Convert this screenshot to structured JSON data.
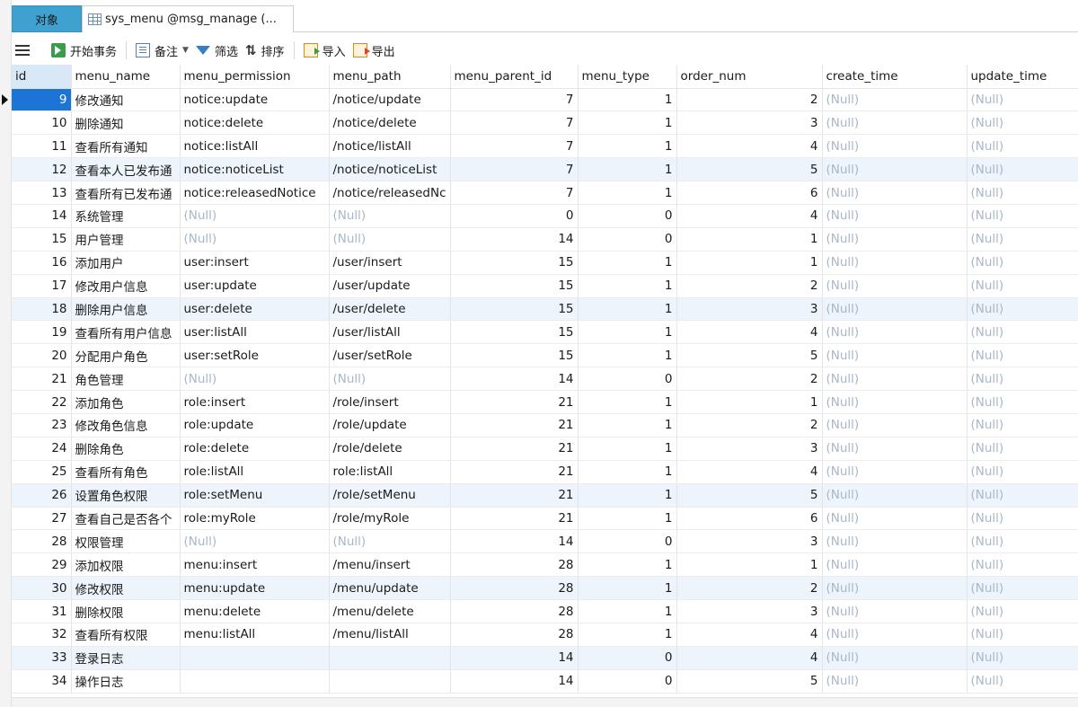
{
  "tabs": {
    "objects": "对象",
    "table": "sys_menu @msg_manage (..."
  },
  "toolbar": {
    "begin_transaction": "开始事务",
    "note": "备注",
    "filter": "筛选",
    "sort": "排序",
    "import": "导入",
    "export": "导出"
  },
  "columns": [
    "id",
    "menu_name",
    "menu_permission",
    "menu_path",
    "menu_parent_id",
    "menu_type",
    "order_num",
    "create_time",
    "update_time"
  ],
  "null_text": "(Null)",
  "rows": [
    {
      "id": "9",
      "menu_name": "修改通知",
      "menu_permission": "notice:update",
      "menu_path": "/notice/update",
      "menu_parent_id": "7",
      "menu_type": "1",
      "order_num": "2",
      "create_time": "(Null)",
      "update_time": "(Null)"
    },
    {
      "id": "10",
      "menu_name": "删除通知",
      "menu_permission": "notice:delete",
      "menu_path": "/notice/delete",
      "menu_parent_id": "7",
      "menu_type": "1",
      "order_num": "3",
      "create_time": "(Null)",
      "update_time": "(Null)"
    },
    {
      "id": "11",
      "menu_name": "查看所有通知",
      "menu_permission": "notice:listAll",
      "menu_path": "/notice/listAll",
      "menu_parent_id": "7",
      "menu_type": "1",
      "order_num": "4",
      "create_time": "(Null)",
      "update_time": "(Null)"
    },
    {
      "id": "12",
      "menu_name": "查看本人已发布通",
      "menu_permission": "notice:noticeList",
      "menu_path": "/notice/noticeList",
      "menu_parent_id": "7",
      "menu_type": "1",
      "order_num": "5",
      "create_time": "(Null)",
      "update_time": "(Null)"
    },
    {
      "id": "13",
      "menu_name": "查看所有已发布通",
      "menu_permission": "notice:releasedNotice",
      "menu_path": "/notice/releasedNc",
      "menu_parent_id": "7",
      "menu_type": "1",
      "order_num": "6",
      "create_time": "(Null)",
      "update_time": "(Null)"
    },
    {
      "id": "14",
      "menu_name": "系统管理",
      "menu_permission": "(Null)",
      "menu_path": "(Null)",
      "menu_parent_id": "0",
      "menu_type": "0",
      "order_num": "4",
      "create_time": "(Null)",
      "update_time": "(Null)"
    },
    {
      "id": "15",
      "menu_name": "用户管理",
      "menu_permission": "(Null)",
      "menu_path": "(Null)",
      "menu_parent_id": "14",
      "menu_type": "0",
      "order_num": "1",
      "create_time": "(Null)",
      "update_time": "(Null)"
    },
    {
      "id": "16",
      "menu_name": "添加用户",
      "menu_permission": "user:insert",
      "menu_path": "/user/insert",
      "menu_parent_id": "15",
      "menu_type": "1",
      "order_num": "1",
      "create_time": "(Null)",
      "update_time": "(Null)"
    },
    {
      "id": "17",
      "menu_name": "修改用户信息",
      "menu_permission": "user:update",
      "menu_path": "/user/update",
      "menu_parent_id": "15",
      "menu_type": "1",
      "order_num": "2",
      "create_time": "(Null)",
      "update_time": "(Null)"
    },
    {
      "id": "18",
      "menu_name": "删除用户信息",
      "menu_permission": "user:delete",
      "menu_path": "/user/delete",
      "menu_parent_id": "15",
      "menu_type": "1",
      "order_num": "3",
      "create_time": "(Null)",
      "update_time": "(Null)"
    },
    {
      "id": "19",
      "menu_name": "查看所有用户信息",
      "menu_permission": "user:listAll",
      "menu_path": "/user/listAll",
      "menu_parent_id": "15",
      "menu_type": "1",
      "order_num": "4",
      "create_time": "(Null)",
      "update_time": "(Null)"
    },
    {
      "id": "20",
      "menu_name": "分配用户角色",
      "menu_permission": "user:setRole",
      "menu_path": "/user/setRole",
      "menu_parent_id": "15",
      "menu_type": "1",
      "order_num": "5",
      "create_time": "(Null)",
      "update_time": "(Null)"
    },
    {
      "id": "21",
      "menu_name": "角色管理",
      "menu_permission": "(Null)",
      "menu_path": "(Null)",
      "menu_parent_id": "14",
      "menu_type": "0",
      "order_num": "2",
      "create_time": "(Null)",
      "update_time": "(Null)"
    },
    {
      "id": "22",
      "menu_name": "添加角色",
      "menu_permission": "role:insert",
      "menu_path": "/role/insert",
      "menu_parent_id": "21",
      "menu_type": "1",
      "order_num": "1",
      "create_time": "(Null)",
      "update_time": "(Null)"
    },
    {
      "id": "23",
      "menu_name": "修改角色信息",
      "menu_permission": "role:update",
      "menu_path": "/role/update",
      "menu_parent_id": "21",
      "menu_type": "1",
      "order_num": "2",
      "create_time": "(Null)",
      "update_time": "(Null)"
    },
    {
      "id": "24",
      "menu_name": "删除角色",
      "menu_permission": "role:delete",
      "menu_path": "/role/delete",
      "menu_parent_id": "21",
      "menu_type": "1",
      "order_num": "3",
      "create_time": "(Null)",
      "update_time": "(Null)"
    },
    {
      "id": "25",
      "menu_name": "查看所有角色",
      "menu_permission": "role:listAll",
      "menu_path": "role:listAll",
      "menu_parent_id": "21",
      "menu_type": "1",
      "order_num": "4",
      "create_time": "(Null)",
      "update_time": "(Null)"
    },
    {
      "id": "26",
      "menu_name": "设置角色权限",
      "menu_permission": "role:setMenu",
      "menu_path": "/role/setMenu",
      "menu_parent_id": "21",
      "menu_type": "1",
      "order_num": "5",
      "create_time": "(Null)",
      "update_time": "(Null)"
    },
    {
      "id": "27",
      "menu_name": "查看自己是否各个",
      "menu_permission": "role:myRole",
      "menu_path": "/role/myRole",
      "menu_parent_id": "21",
      "menu_type": "1",
      "order_num": "6",
      "create_time": "(Null)",
      "update_time": "(Null)"
    },
    {
      "id": "28",
      "menu_name": "权限管理",
      "menu_permission": "(Null)",
      "menu_path": "(Null)",
      "menu_parent_id": "14",
      "menu_type": "0",
      "order_num": "3",
      "create_time": "(Null)",
      "update_time": "(Null)"
    },
    {
      "id": "29",
      "menu_name": "添加权限",
      "menu_permission": "menu:insert",
      "menu_path": "/menu/insert",
      "menu_parent_id": "28",
      "menu_type": "1",
      "order_num": "1",
      "create_time": "(Null)",
      "update_time": "(Null)"
    },
    {
      "id": "30",
      "menu_name": "修改权限",
      "menu_permission": "menu:update",
      "menu_path": "/menu/update",
      "menu_parent_id": "28",
      "menu_type": "1",
      "order_num": "2",
      "create_time": "(Null)",
      "update_time": "(Null)"
    },
    {
      "id": "31",
      "menu_name": "删除权限",
      "menu_permission": "menu:delete",
      "menu_path": "/menu/delete",
      "menu_parent_id": "28",
      "menu_type": "1",
      "order_num": "3",
      "create_time": "(Null)",
      "update_time": "(Null)"
    },
    {
      "id": "32",
      "menu_name": "查看所有权限",
      "menu_permission": "menu:listAll",
      "menu_path": "/menu/listAll",
      "menu_parent_id": "28",
      "menu_type": "1",
      "order_num": "4",
      "create_time": "(Null)",
      "update_time": "(Null)"
    },
    {
      "id": "33",
      "menu_name": "登录日志",
      "menu_permission": "",
      "menu_path": "",
      "menu_parent_id": "14",
      "menu_type": "0",
      "order_num": "4",
      "create_time": "(Null)",
      "update_time": "(Null)"
    },
    {
      "id": "34",
      "menu_name": "操作日志",
      "menu_permission": "",
      "menu_path": "",
      "menu_parent_id": "14",
      "menu_type": "0",
      "order_num": "5",
      "create_time": "(Null)",
      "update_time": "(Null)"
    }
  ],
  "colors": {
    "objects_tab": "#3ea1cf",
    "selected_cell": "#1b74d6",
    "null_text": "#a9b7c9",
    "alt_row": "#eef4fb"
  }
}
